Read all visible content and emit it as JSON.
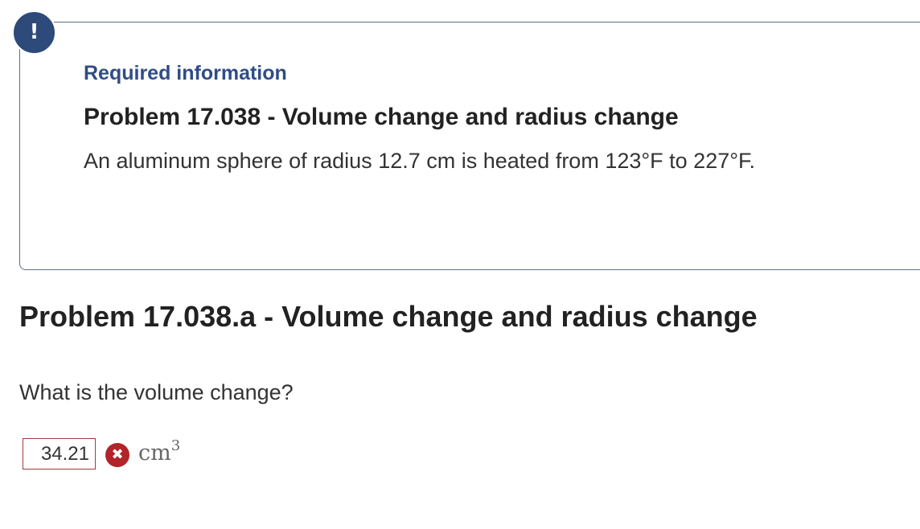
{
  "alert": {
    "icon": "exclamation-icon",
    "symbol": "!"
  },
  "info": {
    "label": "Required information",
    "title": "Problem 17.038 - Volume change and radius change",
    "text": "An aluminum sphere of radius 12.7 cm is heated from 123°F to 227°F."
  },
  "part": {
    "title": "Problem 17.038.a - Volume change and radius change",
    "question": "What is the volume change?",
    "answer_value": "34.21",
    "status_icon": "incorrect-x-icon",
    "status_symbol": "✖",
    "unit_base": "cm",
    "unit_exponent": "3"
  },
  "colors": {
    "accent": "#2f4d85",
    "alert_bg": "#2d4a7a",
    "error": "#b1242a",
    "answer_border": "#a33b3b"
  }
}
